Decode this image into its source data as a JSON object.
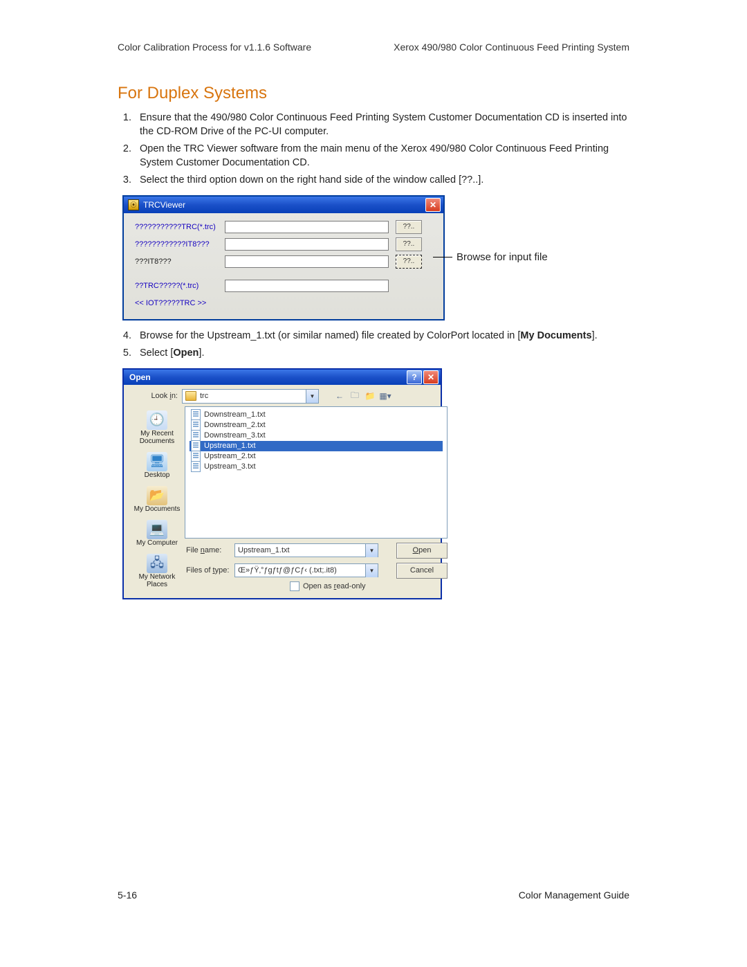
{
  "header": {
    "left": "Color Calibration Process for v1.1.6 Software",
    "right": "Xerox 490/980 Color Continuous Feed Printing System"
  },
  "section_title": "For Duplex Systems",
  "steps_a": [
    "Ensure that the 490/980 Color Continuous Feed Printing System Customer Documentation CD is inserted into the CD-ROM Drive of the PC-UI computer.",
    "Open the TRC Viewer software from the main menu of the Xerox 490/980 Color Continuous Feed Printing System Customer Documentation CD.",
    "Select the third option down on the right hand side of the window called [??..]."
  ],
  "trc": {
    "title": "TRCViewer",
    "labels": {
      "r1": "???????????TRC(*.trc)",
      "r2": "????????????IT8???",
      "r3": "???IT8???",
      "r4": "??TRC?????(*.trc)",
      "r5": "<< IOT?????TRC >>"
    },
    "browse_btn": "??..",
    "callout": "Browse for input file"
  },
  "steps_b": {
    "s4_pre": "Browse for the Upstream_1.txt (or similar named) file created by ColorPort located in [",
    "s4_bold": "My Documents",
    "s4_post": "].",
    "s5_pre": "Select [",
    "s5_bold": "Open",
    "s5_post": "]."
  },
  "open": {
    "title": "Open",
    "lookin_label": "Look in:",
    "lookin_value": "trc",
    "places": {
      "recent": "My Recent Documents",
      "desktop": "Desktop",
      "mydocs": "My Documents",
      "mycomp": "My Computer",
      "netplaces": "My Network Places"
    },
    "files": [
      "Downstream_1.txt",
      "Downstream_2.txt",
      "Downstream_3.txt",
      "Upstream_1.txt",
      "Upstream_2.txt",
      "Upstream_3.txt"
    ],
    "selected_index": 3,
    "filename_label": "File name:",
    "filename_value": "Upstream_1.txt",
    "filetype_label": "Files of type:",
    "filetype_value": "Œ»ƒŸ‚°ƒgƒtƒ@ƒCƒ‹ (.txt;.it8)",
    "open_btn": "Open",
    "cancel_btn": "Cancel",
    "readonly_label": "Open as read-only"
  },
  "footer": {
    "left": "5-16",
    "right": "Color Management Guide"
  }
}
